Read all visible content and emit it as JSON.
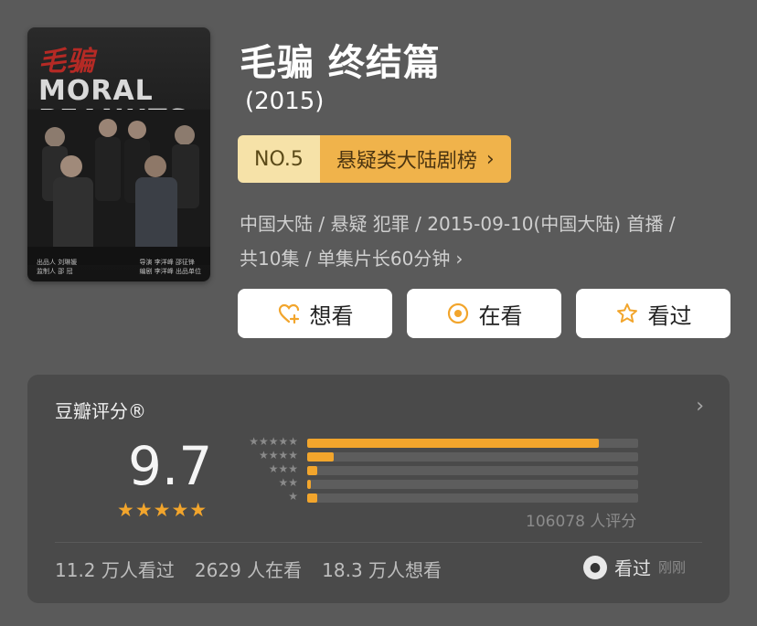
{
  "poster": {
    "title_red": "毛骗",
    "title_line1": "MORAL",
    "title_line2": "PEANUTS",
    "credits_left": "出品人 刘琳媛\n监制人 邵 冠",
    "credits_right": "导演 李洋峰 邵征锋\n编剧 李洋峰 出品单位"
  },
  "title": "毛骗 终结篇",
  "year": "(2015)",
  "ranking": {
    "number": "NO.5",
    "list": "悬疑类大陆剧榜",
    "chevron": "›"
  },
  "meta": {
    "line1": "中国大陆 / 悬疑 犯罪 / 2015-09-10(中国大陆) 首播 /",
    "line2": "共10集 / 单集片长60分钟",
    "chevron": "›"
  },
  "buttons": {
    "want": "想看",
    "watching": "在看",
    "watched": "看过"
  },
  "rating": {
    "label": "豆瓣评分®",
    "chevron": "›",
    "score": "9.7",
    "stars": "★★★★★",
    "star_rows": [
      "★★★★★",
      "★★★★",
      "★★★",
      "★★",
      "★"
    ],
    "distribution": [
      0.88,
      0.08,
      0.03,
      0.01,
      0.03
    ],
    "count": "106078 人评分"
  },
  "stats": {
    "watched": "11.2 万人看过",
    "watching": "2629 人在看",
    "want": "18.3 万人想看"
  },
  "friend": {
    "action": "看过",
    "time": "刚刚"
  },
  "colors": {
    "background": "#5a5a5a",
    "panel": "#4a4a4a",
    "accent": "#f2a52c",
    "rank_light": "#f6e2a8",
    "rank_dark": "#f0b34b"
  }
}
